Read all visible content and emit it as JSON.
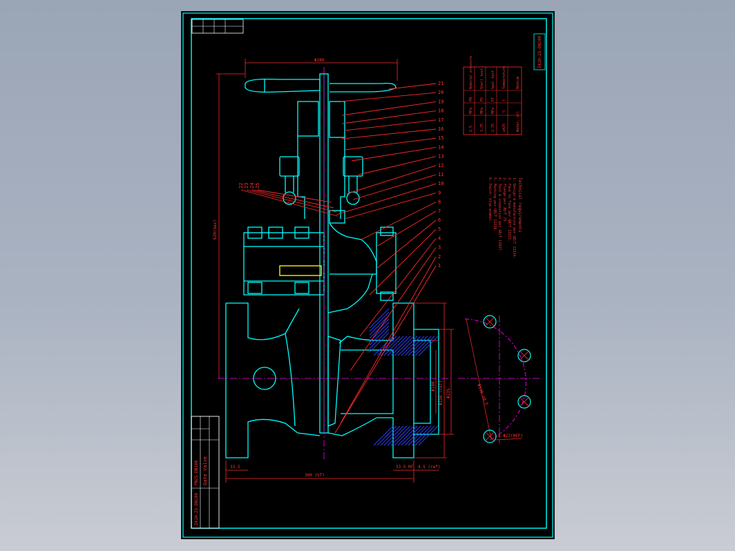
{
  "drawing": {
    "sheet_code_top": "Z41H-25-DN100",
    "sheet_code_title": "Z41H-25-DN100",
    "title_name": "Gate Valve",
    "title_sub": "PN25 DN100",
    "callouts": [
      "1",
      "2",
      "3",
      "4",
      "5",
      "6",
      "7",
      "8",
      "9",
      "10",
      "11",
      "12",
      "13",
      "14",
      "15",
      "16",
      "17",
      "18",
      "19",
      "20",
      "21"
    ],
    "callouts_left": [
      "22",
      "23",
      "24",
      "25"
    ],
    "dims": {
      "top_width": "Φ280",
      "overall_height": "620(max)",
      "flange_thk_left": "33.5",
      "face_to_face": "300 (ST)",
      "flange_thk_right": "33.5 RF",
      "raised_face": "4.5 (ref)",
      "bolt_circle": "Φ190 ±0.5",
      "bolt_holes": "8-Φ22(REF)",
      "od_1": "Φ235",
      "od_2": "Φ156 (ref)",
      "od_3": "Φ100"
    },
    "notes_heading": "Technical requirements",
    "notes_lines": [
      "1. Design & manufacture per GB/T 12234.",
      "2. Face to face per GB/T 12221.",
      "3. Flange per JB/T 79.",
      "4. Test & inspection per GB/T 13927.",
      "5. Marking per GB/T 12220.",
      "6. Paint: blue enamel."
    ],
    "spec_table": {
      "rows": [
        [
          "Nominal pressure",
          "PN",
          "MPa",
          "2.5"
        ],
        [
          "Shell test",
          "PS",
          "MPa",
          "3.75"
        ],
        [
          "Seal test",
          "PT",
          "MPa",
          "2.75"
        ],
        [
          "Temperature",
          "t",
          "°C",
          "≤425"
        ],
        [
          "Medium",
          "",
          "",
          "Water, oil"
        ]
      ]
    }
  },
  "colors": {
    "sheet": "#000000",
    "border": "#00ffff",
    "outline": "#00ffff",
    "leader": "#ff2a2a",
    "dimension": "#ff2a2a",
    "text": "#ff3333",
    "centerline": "#ff00ff",
    "hatch": "#3040ff",
    "highlight": "#ffee00",
    "white": "#ffffff"
  }
}
